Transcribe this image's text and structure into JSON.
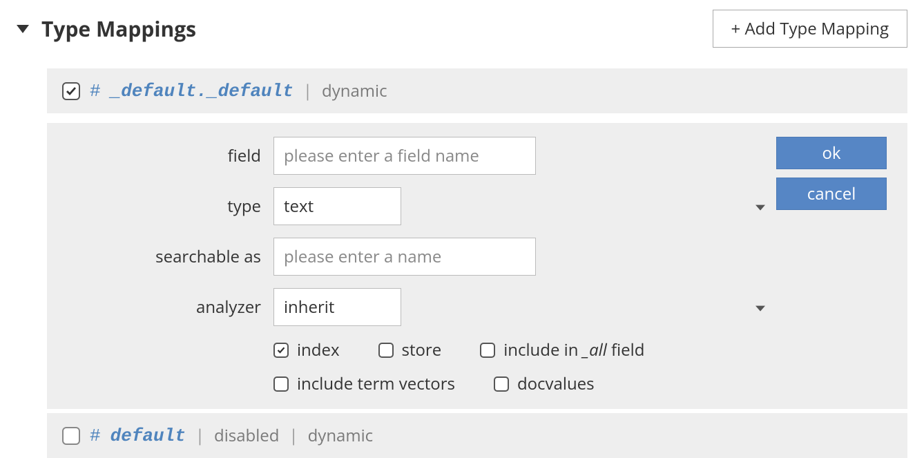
{
  "header": {
    "title": "Type Mappings",
    "add_button": "+ Add Type Mapping"
  },
  "mapping1": {
    "checked": true,
    "hash": "#",
    "name": "_default._default",
    "sep": "|",
    "tag": "dynamic"
  },
  "form": {
    "labels": {
      "field": "field",
      "type": "type",
      "searchable_as": "searchable as",
      "analyzer": "analyzer"
    },
    "field_placeholder": "please enter a field name",
    "field_value": "",
    "type_value": "text",
    "searchable_placeholder": "please enter a name",
    "searchable_value": "",
    "analyzer_value": "inherit",
    "opts": {
      "index": "index",
      "store": "store",
      "include_all_prefix": "include in ",
      "include_all_italic": "_all",
      "include_all_suffix": " field",
      "include_term_vectors": "include term vectors",
      "docvalues": "docvalues"
    },
    "opts_state": {
      "index": true,
      "store": false,
      "include_all": false,
      "include_term_vectors": false,
      "docvalues": false
    },
    "actions": {
      "ok": "ok",
      "cancel": "cancel"
    }
  },
  "mapping2": {
    "checked": false,
    "hash": "#",
    "name": "default",
    "sep1": "|",
    "tag1": "disabled",
    "sep2": "|",
    "tag2": "dynamic"
  }
}
